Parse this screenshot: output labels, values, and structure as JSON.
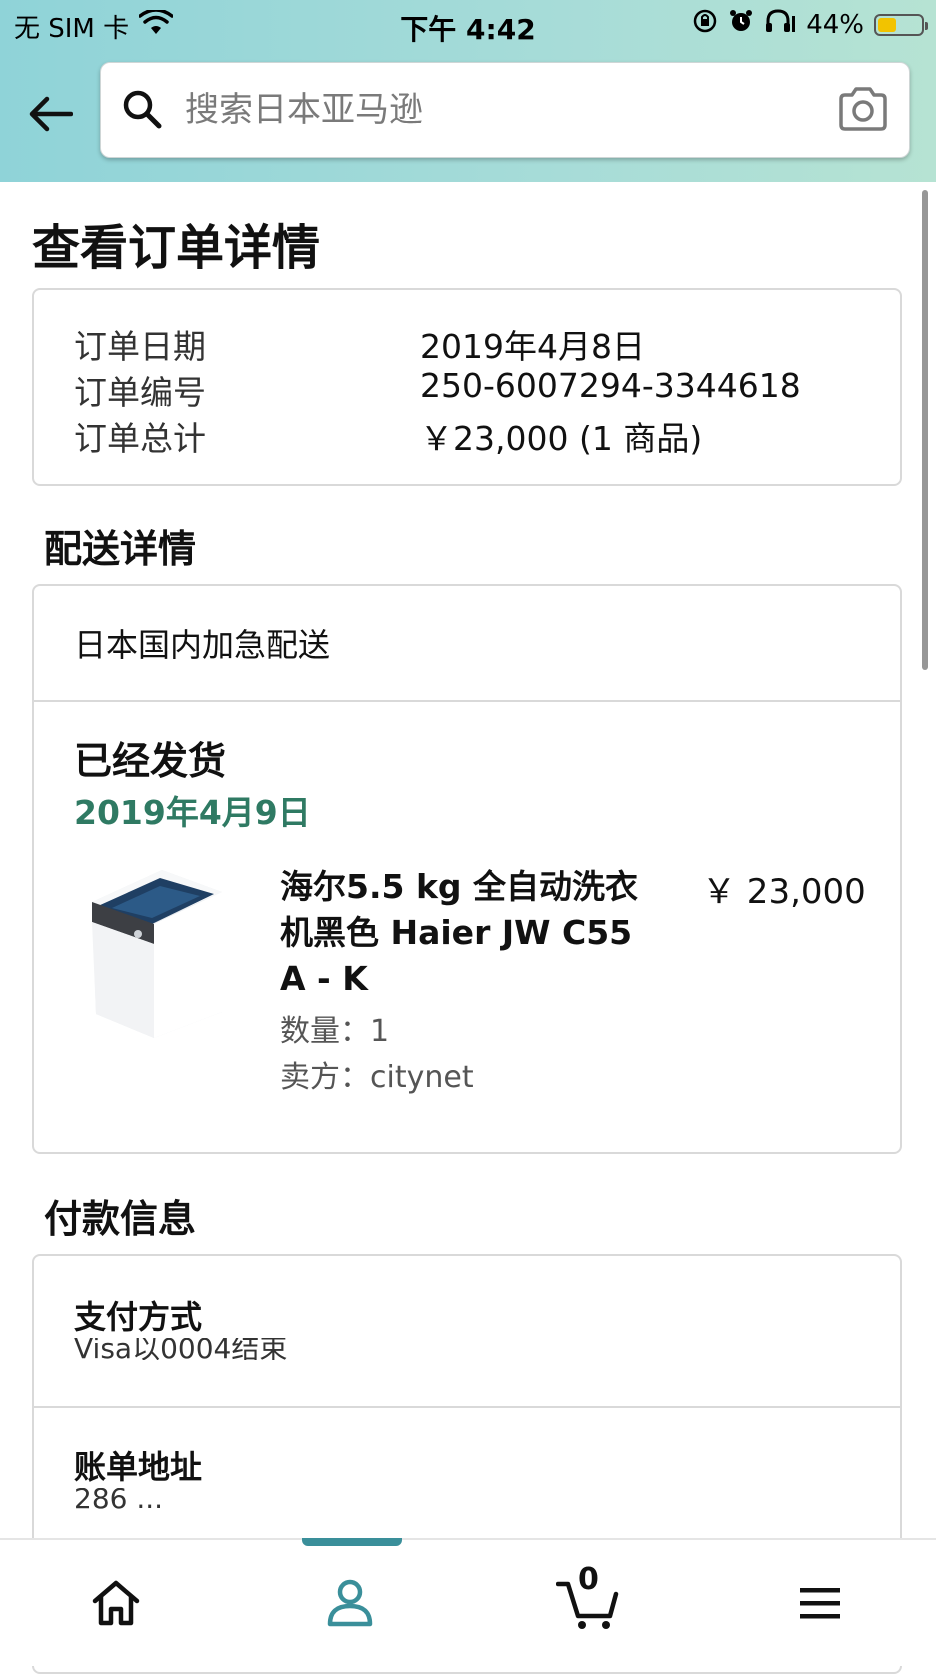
{
  "status_bar": {
    "carrier": "无 SIM 卡",
    "time": "下午 4:42",
    "battery": "44%"
  },
  "search": {
    "placeholder": "搜索日本亚马逊"
  },
  "page": {
    "title": "查看订单详情"
  },
  "order_summary": {
    "date_label": "订单日期",
    "date_value": "2019年4月8日",
    "number_label": "订单编号",
    "number_value": "250-6007294-3344618",
    "total_label": "订单总计",
    "total_value": "￥23,000 (1 商品)"
  },
  "delivery": {
    "section_title": "配送详情",
    "method": "日本国内加急配送",
    "status": "已经发货",
    "ship_date": "2019年4月9日",
    "product": {
      "title": "海尔5.5 kg 全自动洗衣机黑色 Haier JW C55 A - K",
      "price": "￥ 23,000",
      "quantity": "数量：1",
      "seller": "卖方：citynet"
    }
  },
  "payment": {
    "section_title": "付款信息",
    "method_label": "支付方式",
    "method_value": "Visa以0004结束",
    "billing_label": "账单地址",
    "billing_value": "286 ..."
  },
  "bottom_nav": {
    "cart_count": "0"
  },
  "colors": {
    "header_gradient_start": "#8fd3d8",
    "header_gradient_end": "#b6e3d3",
    "ship_date_green": "#2f7a63",
    "nav_active": "#3a8f9a"
  },
  "icons": {
    "back": "back-arrow-icon",
    "search": "search-icon",
    "camera": "camera-icon",
    "home": "home-icon",
    "account": "account-icon",
    "cart": "cart-icon",
    "menu": "menu-icon"
  }
}
